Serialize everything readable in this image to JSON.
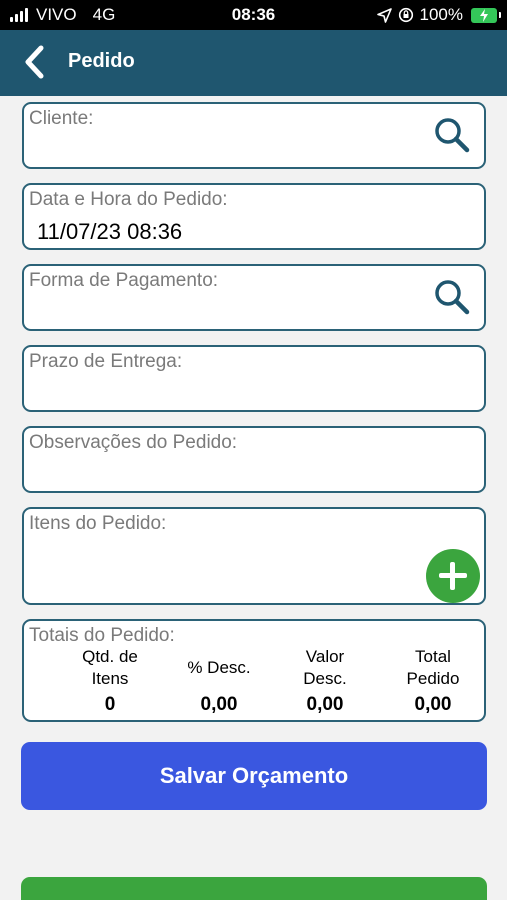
{
  "status_bar": {
    "carrier": "VIVO",
    "network": "4G",
    "time": "08:36",
    "battery": "100%"
  },
  "header": {
    "title": "Pedido"
  },
  "fields": {
    "cliente": {
      "label": "Cliente:"
    },
    "data_hora": {
      "label": "Data e Hora do Pedido:",
      "value": "11/07/23 08:36"
    },
    "forma_pagamento": {
      "label": "Forma de Pagamento:"
    },
    "prazo_entrega": {
      "label": "Prazo de Entrega:"
    },
    "observacoes": {
      "label": "Observações do Pedido:"
    },
    "itens": {
      "label": "Itens do Pedido:"
    }
  },
  "totals": {
    "label": "Totais do Pedido:",
    "qtd_itens": {
      "line1": "Qtd. de",
      "line2": "Itens",
      "value": "0"
    },
    "perc_desc": {
      "line1": "% Desc.",
      "value": "0,00"
    },
    "valor_desc": {
      "line1": "Valor",
      "line2": "Desc.",
      "value": "0,00"
    },
    "total_pedido": {
      "line1": "Total",
      "line2": "Pedido",
      "value": "0,00"
    }
  },
  "actions": {
    "save_label": "Salvar Orçamento"
  },
  "colors": {
    "header": "#1f566f",
    "border": "#2b6277",
    "primary": "#3a57e0",
    "success": "#3ba53e"
  }
}
